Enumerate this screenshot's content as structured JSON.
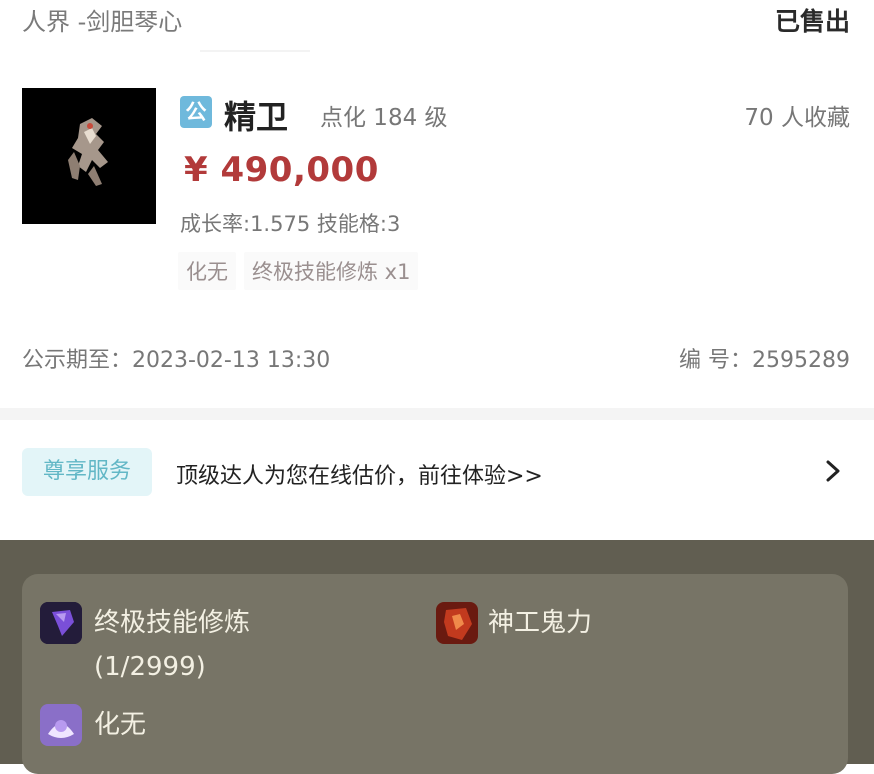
{
  "header": {
    "server": "人界 -剑胆琴心",
    "status": "已售出"
  },
  "pet": {
    "badge": "公",
    "name": "精卫",
    "level": "点化 184 级",
    "favorites": "70 人收藏",
    "price": "¥ 490,000",
    "stats": "成长率:1.575 技能格:3",
    "tags": [
      "化无",
      "终极技能修炼 x1"
    ]
  },
  "listing": {
    "publicity": "公示期至：2023-02-13 13:30",
    "serial": "编 号：2595289"
  },
  "service": {
    "badge": "尊享服务",
    "text": "顶级达人为您在线估价，前往体验>>",
    "chevron_icon": "chevron-right-icon"
  },
  "skills": [
    {
      "name": "终极技能修炼",
      "detail": "(1/2999)",
      "icon": "purple-gem-icon"
    },
    {
      "name": "神工鬼力",
      "detail": "",
      "icon": "red-fist-icon"
    },
    {
      "name": "化无",
      "detail": "",
      "icon": "purple-swirl-icon"
    }
  ],
  "colors": {
    "price": "#b23a3a",
    "service_badge_bg": "#e3f5f8",
    "service_badge_text": "#62b7c6",
    "pet_badge": "#6fb9dc",
    "bottom_bg": "#615e51",
    "bottom_panel": "#777466"
  }
}
